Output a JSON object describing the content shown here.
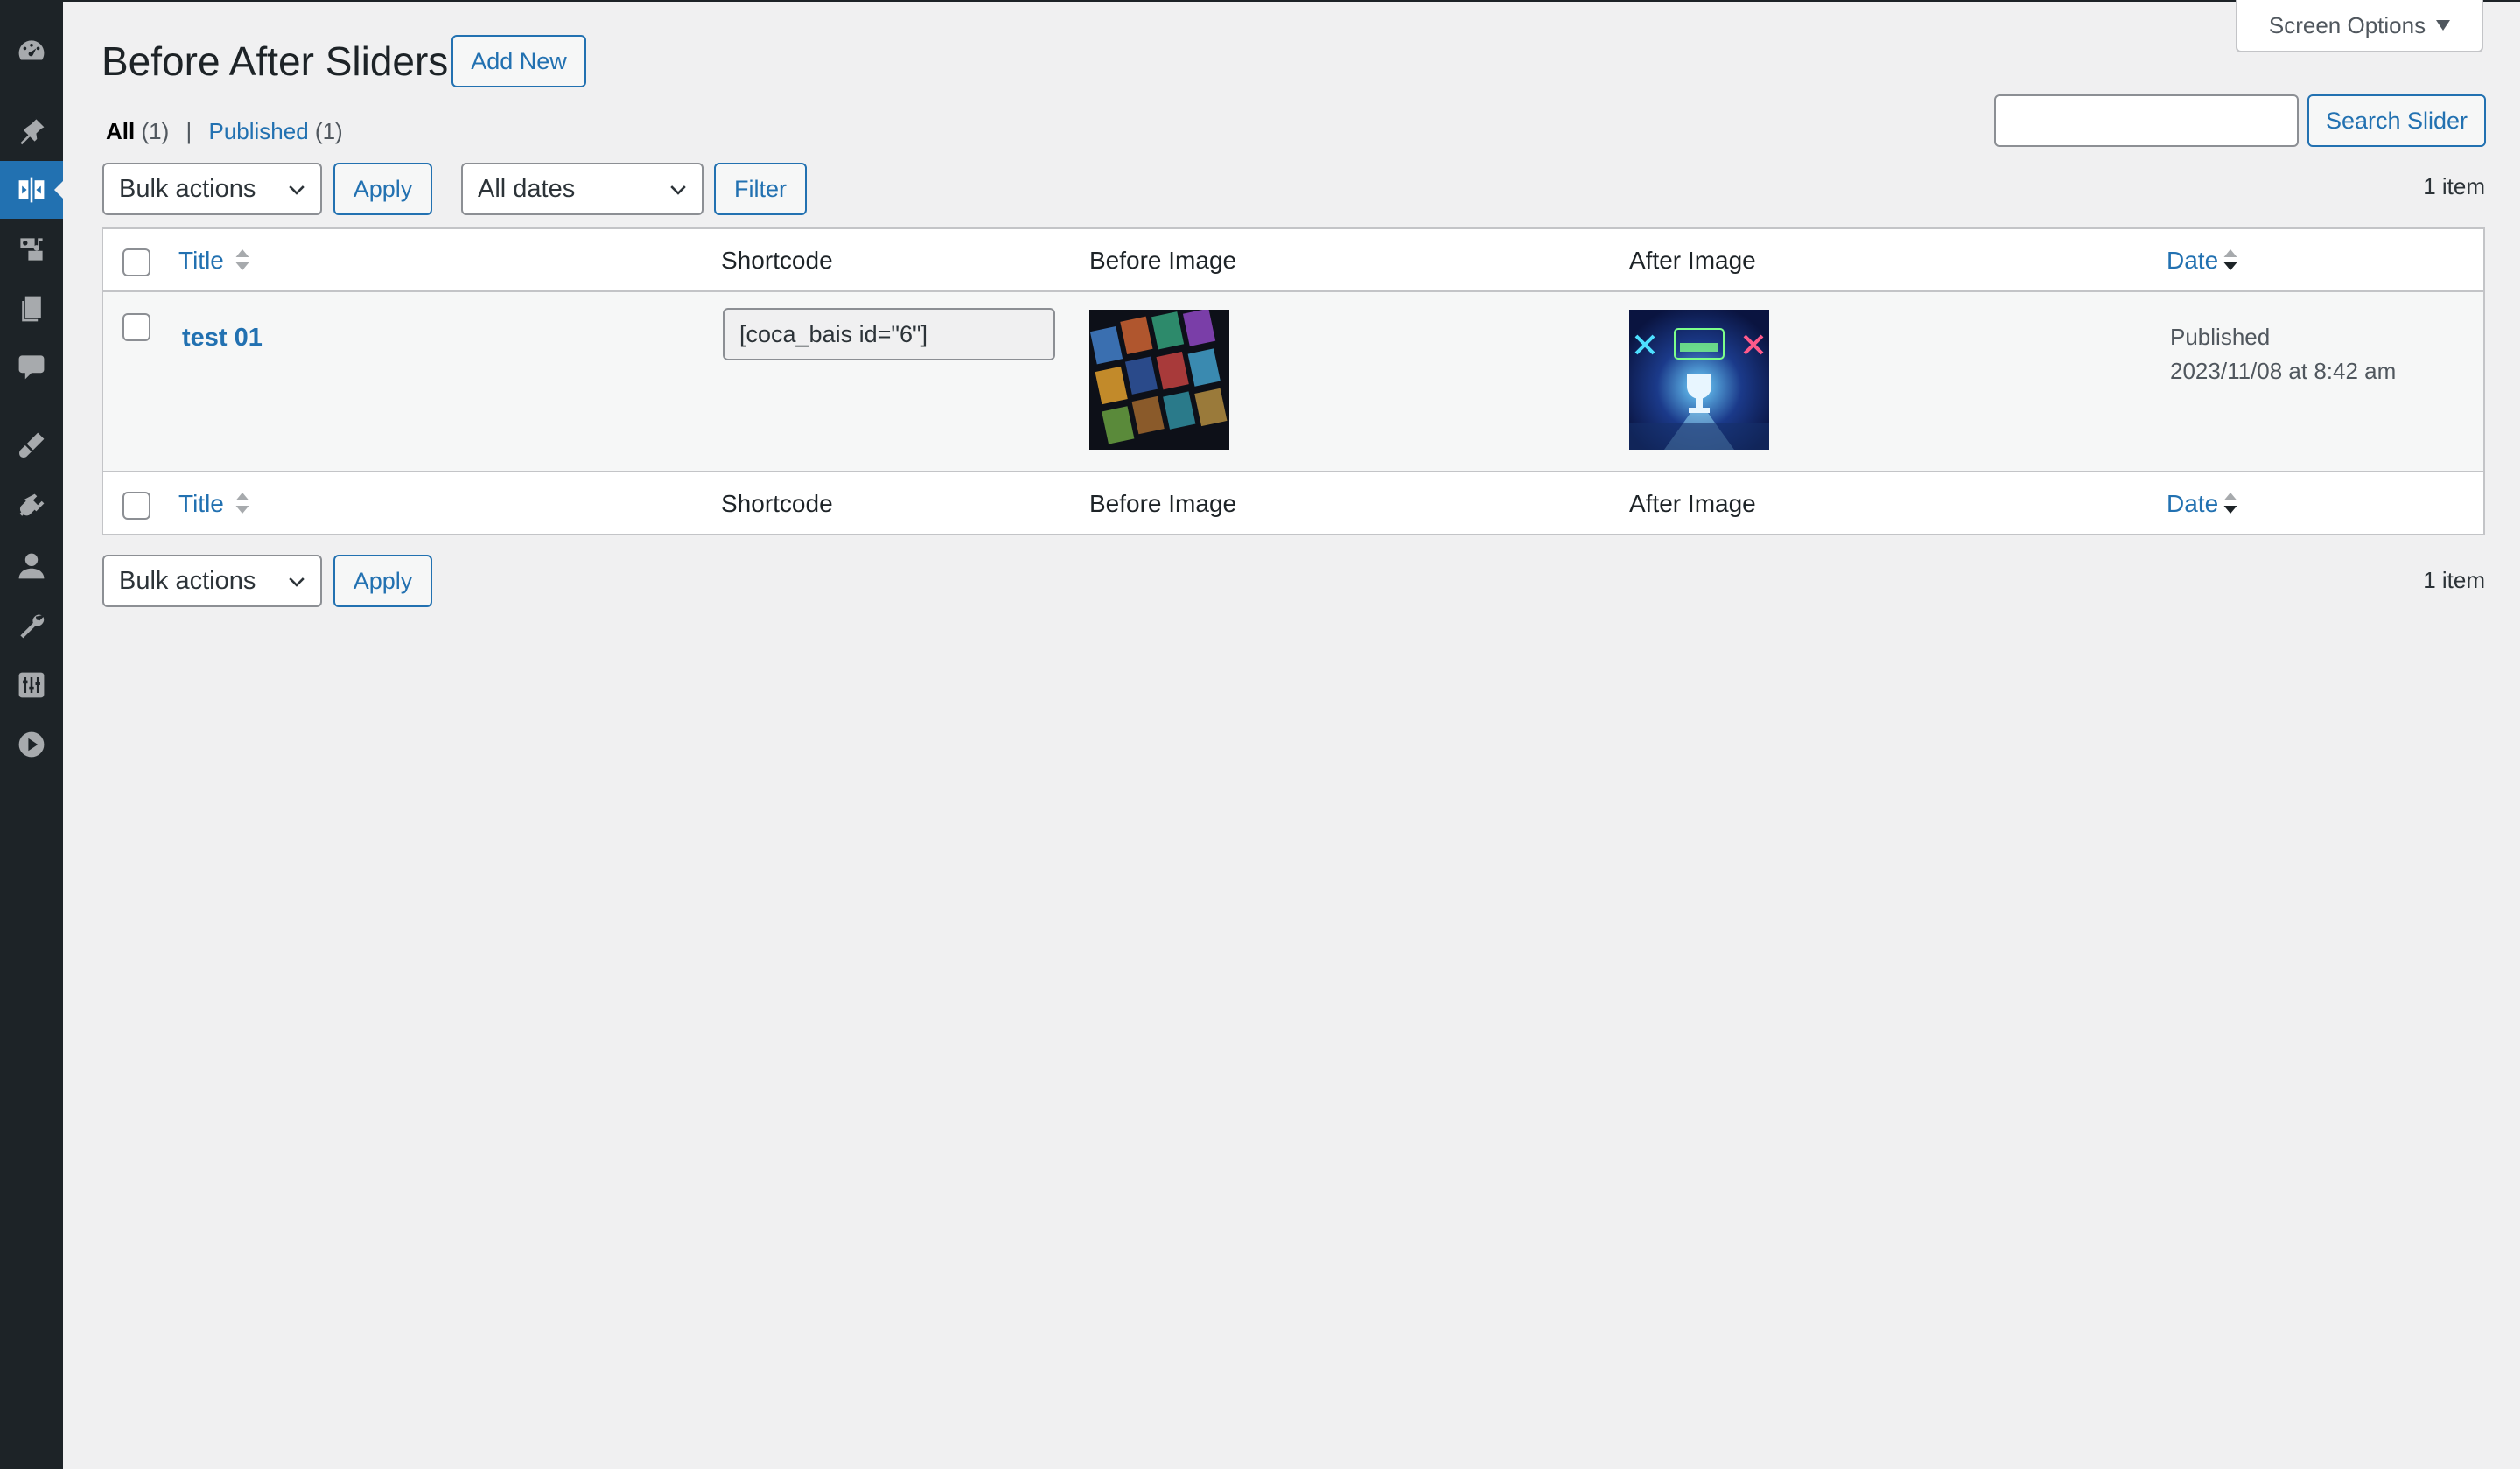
{
  "menu": {
    "icons": [
      "dashboard-icon",
      "pin-icon",
      "before-after-slider-icon",
      "media-icon",
      "pages-icon",
      "comments-icon",
      "appearance-icon",
      "plugins-icon",
      "users-icon",
      "tools-icon",
      "settings-icon",
      "video-icon"
    ],
    "current": "before-after-slider-icon"
  },
  "header": {
    "screen_options": "Screen Options",
    "title": "Before After Sliders",
    "add_new": "Add New"
  },
  "views": {
    "all_label": "All",
    "all_count": "(1)",
    "separator": "|",
    "published_label": "Published",
    "published_count": "(1)"
  },
  "search": {
    "value": "",
    "button": "Search Slider"
  },
  "tablenav_top": {
    "bulk_actions": "Bulk actions",
    "apply": "Apply",
    "dates": "All dates",
    "filter": "Filter",
    "count": "1 item"
  },
  "tablenav_bottom": {
    "bulk_actions": "Bulk actions",
    "apply": "Apply",
    "count": "1 item"
  },
  "table": {
    "columns": {
      "title": "Title",
      "shortcode": "Shortcode",
      "before_image": "Before Image",
      "after_image": "After Image",
      "date": "Date"
    },
    "rows": [
      {
        "title": "test 01",
        "shortcode": "[coca_bais id=\"6\"]",
        "before_image": "game-covers-grid-thumbnail",
        "after_image": "ready-to-battle-thumbnail",
        "status": "Published",
        "date": "2023/11/08 at 8:42 am"
      }
    ]
  },
  "colors": {
    "sidebar": "#1d2327",
    "accent": "#2271b1",
    "background": "#f0f0f1"
  }
}
